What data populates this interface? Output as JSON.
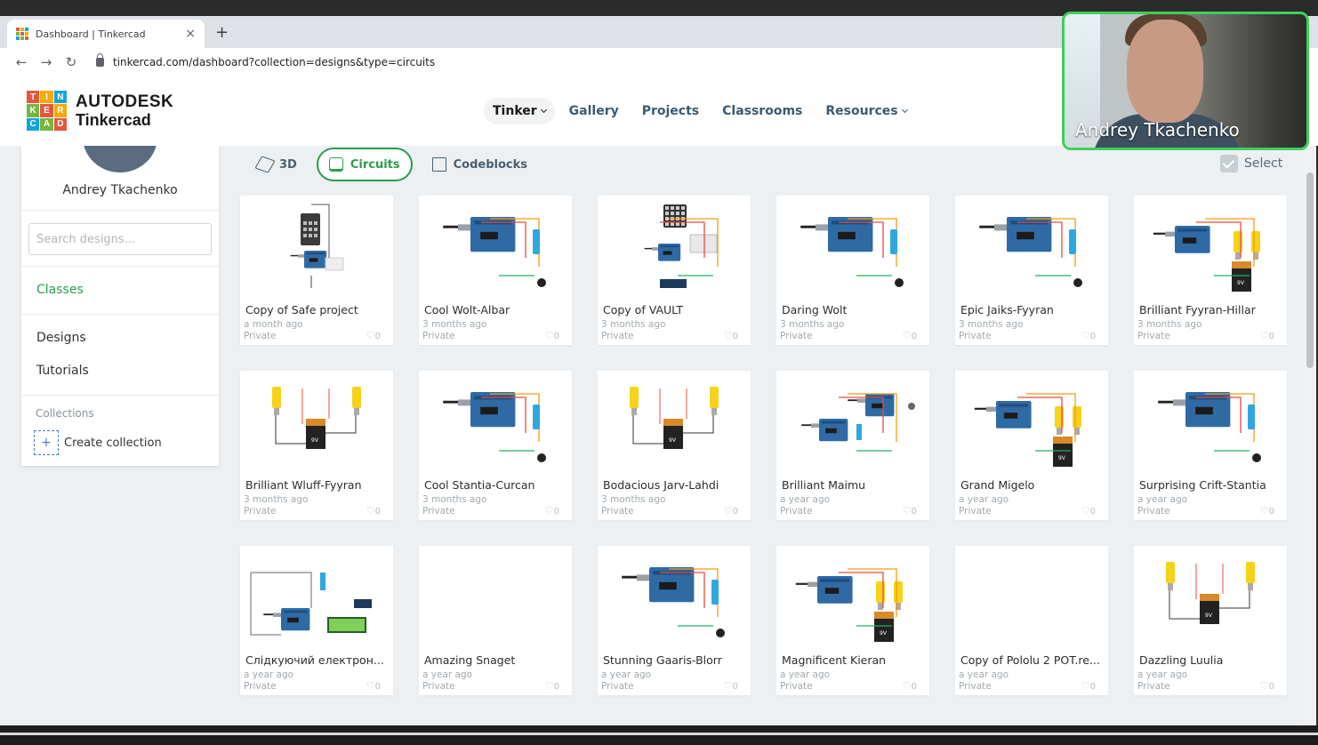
{
  "browser": {
    "tab_title": "Dashboard | Tinkercad",
    "close_glyph": "×",
    "newtab_glyph": "+",
    "url": "tinkercad.com/dashboard?collection=designs&type=circuits",
    "back_glyph": "←",
    "forward_glyph": "→",
    "reload_glyph": "↻"
  },
  "brand": {
    "logo_letters": [
      "T",
      "I",
      "N",
      "K",
      "E",
      "R",
      "C",
      "A",
      "D"
    ],
    "logo_colors": [
      "#e2583e",
      "#f8a900",
      "#17a3d8",
      "#75b63e",
      "#e2583e",
      "#f8a900",
      "#17a3d8",
      "#75b63e",
      "#e2583e"
    ],
    "line1": "AUTODESK",
    "line2": "Tinkercad"
  },
  "nav": {
    "items": [
      {
        "label": "Tinker",
        "dropdown": true,
        "active": true
      },
      {
        "label": "Gallery",
        "dropdown": false
      },
      {
        "label": "Projects",
        "dropdown": false
      },
      {
        "label": "Classrooms",
        "dropdown": false
      },
      {
        "label": "Resources",
        "dropdown": true
      }
    ]
  },
  "sidebar": {
    "username": "Andrey Tkachenko",
    "search_placeholder": "Search designs...",
    "classes": "Classes",
    "designs": "Designs",
    "tutorials": "Tutorials",
    "collections_header": "Collections",
    "create_collection": "Create collection"
  },
  "type_tabs": [
    {
      "label": "3D",
      "icon": "cube-icon"
    },
    {
      "label": "Circuits",
      "icon": "circuit-chip-icon",
      "active": true
    },
    {
      "label": "Codeblocks",
      "icon": "codeblocks-icon"
    }
  ],
  "select_label": "Select",
  "designs": [
    {
      "title": "Copy of Safe project",
      "time": "a month ago",
      "privacy": "Private",
      "likes": "0",
      "thumb": "keypad"
    },
    {
      "title": "Cool Wolt-Albar",
      "time": "3 months ago",
      "privacy": "Private",
      "likes": "0",
      "thumb": "arduino"
    },
    {
      "title": "Copy of VAULT",
      "time": "3 months ago",
      "privacy": "Private",
      "likes": "0",
      "thumb": "keypad2"
    },
    {
      "title": "Daring Wolt",
      "time": "3 months ago",
      "privacy": "Private",
      "likes": "0",
      "thumb": "arduino"
    },
    {
      "title": "Epic Jaiks-Fyyran",
      "time": "3 months ago",
      "privacy": "Private",
      "likes": "0",
      "thumb": "arduino"
    },
    {
      "title": "Brilliant Fyyran-Hillar",
      "time": "3 months ago",
      "privacy": "Private",
      "likes": "0",
      "thumb": "arduino-motors"
    },
    {
      "title": "Brilliant Wluff-Fyyran",
      "time": "3 months ago",
      "privacy": "Private",
      "likes": "0",
      "thumb": "battery-motors"
    },
    {
      "title": "Cool Stantia-Curcan",
      "time": "3 months ago",
      "privacy": "Private",
      "likes": "0",
      "thumb": "arduino"
    },
    {
      "title": "Bodacious Jarv-Lahdi",
      "time": "3 months ago",
      "privacy": "Private",
      "likes": "0",
      "thumb": "battery-motors"
    },
    {
      "title": "Brilliant Maimu",
      "time": "a year ago",
      "privacy": "Private",
      "likes": "0",
      "thumb": "two-arduino"
    },
    {
      "title": "Grand Migelo",
      "time": "a year ago",
      "privacy": "Private",
      "likes": "0",
      "thumb": "arduino-motors"
    },
    {
      "title": "Surprising Crift-Stantia",
      "time": "a year ago",
      "privacy": "Private",
      "likes": "0",
      "thumb": "arduino"
    },
    {
      "title": "Слідкуючий електрон...",
      "time": "a year ago",
      "privacy": "Private",
      "likes": "0",
      "thumb": "lcd"
    },
    {
      "title": "Amazing Snaget",
      "time": "a year ago",
      "privacy": "Private",
      "likes": "0",
      "thumb": "empty"
    },
    {
      "title": "Stunning Gaaris-Blorr",
      "time": "a year ago",
      "privacy": "Private",
      "likes": "0",
      "thumb": "arduino"
    },
    {
      "title": "Magnificent Kieran",
      "time": "a year ago",
      "privacy": "Private",
      "likes": "0",
      "thumb": "arduino-motors"
    },
    {
      "title": "Copy of Pololu 2 POT.re...",
      "time": "a year ago",
      "privacy": "Private",
      "likes": "0",
      "thumb": "empty"
    },
    {
      "title": "Dazzling Luulia",
      "time": "a year ago",
      "privacy": "Private",
      "likes": "0",
      "thumb": "battery-motors"
    }
  ],
  "video_call": {
    "participant_name": "Andrey Tkachenko"
  }
}
